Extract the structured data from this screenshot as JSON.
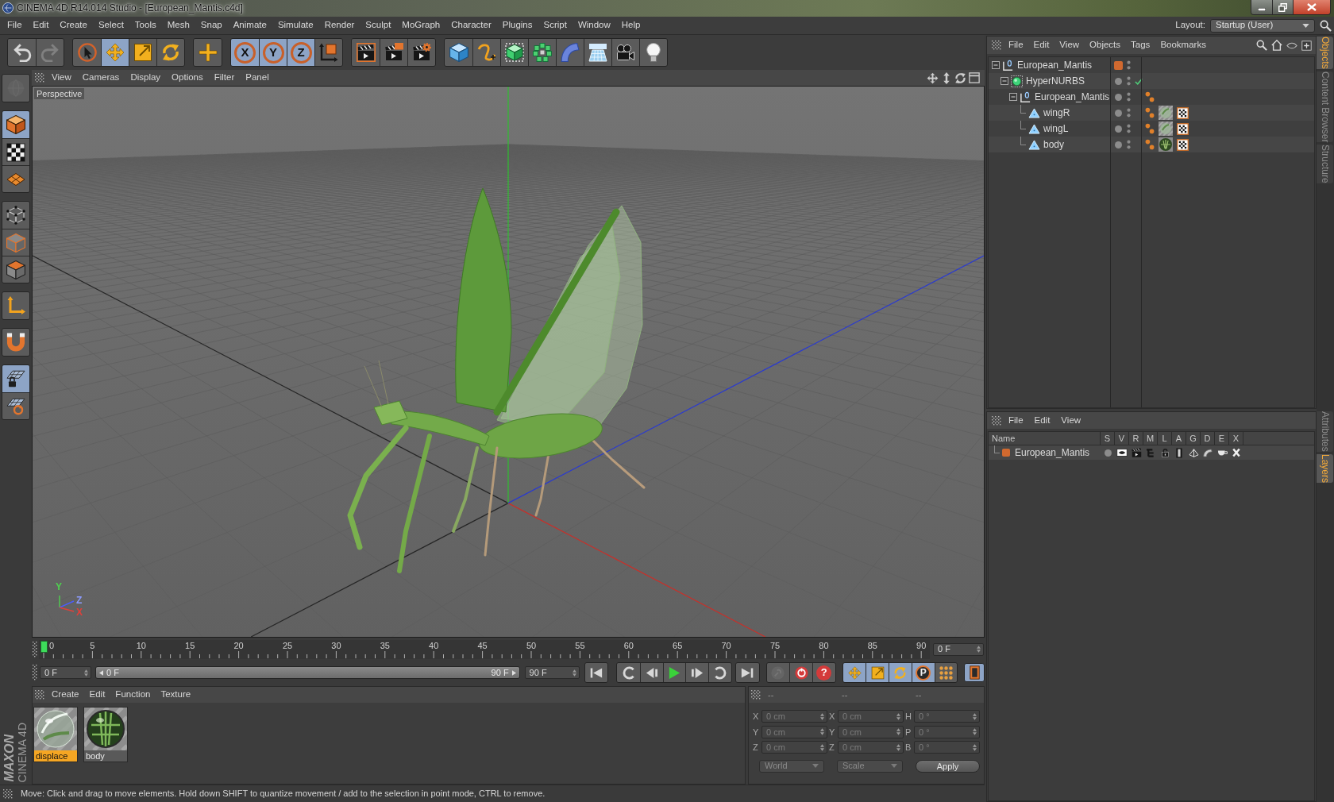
{
  "window": {
    "title": "CINEMA 4D R14.014 Studio - [European_Mantis.c4d]"
  },
  "menu_bar": {
    "items": [
      "File",
      "Edit",
      "Create",
      "Select",
      "Tools",
      "Mesh",
      "Snap",
      "Animate",
      "Simulate",
      "Render",
      "Sculpt",
      "MoGraph",
      "Character",
      "Plugins",
      "Script",
      "Window",
      "Help"
    ],
    "layout_label": "Layout:",
    "layout_value": "Startup (User)"
  },
  "toolbar": {
    "groups": [
      {
        "buttons": [
          {
            "kind": "undo",
            "disabled": false
          },
          {
            "kind": "redo",
            "disabled": true
          }
        ]
      },
      {
        "buttons": [
          {
            "kind": "live_selection",
            "selected": false
          },
          {
            "kind": "move",
            "selected": true
          },
          {
            "kind": "scale",
            "selected": false
          },
          {
            "kind": "rotate",
            "selected": false
          }
        ]
      },
      {
        "buttons": [
          {
            "kind": "add",
            "selected": false
          }
        ]
      },
      {
        "buttons": [
          {
            "kind": "axis",
            "label": "X",
            "selected": true
          },
          {
            "kind": "axis",
            "label": "Y",
            "selected": true
          },
          {
            "kind": "axis",
            "label": "Z",
            "selected": true
          },
          {
            "kind": "coordinates",
            "selected": false
          }
        ]
      },
      {
        "buttons": [
          {
            "kind": "render_view"
          },
          {
            "kind": "render_picture_viewer"
          },
          {
            "kind": "render_settings"
          }
        ]
      },
      {
        "buttons": [
          {
            "kind": "cube"
          },
          {
            "kind": "spline"
          },
          {
            "kind": "nurbs"
          },
          {
            "kind": "cloner"
          },
          {
            "kind": "deformer"
          },
          {
            "kind": "floor"
          },
          {
            "kind": "camera"
          },
          {
            "kind": "light"
          }
        ]
      }
    ]
  },
  "left_toolbar": {
    "groups": [
      {
        "buttons": [
          {
            "kind": "sphere",
            "disabled": true
          }
        ]
      },
      {
        "buttons": [
          {
            "kind": "model",
            "selected": true
          },
          {
            "kind": "texture",
            "selected": false
          },
          {
            "kind": "workplane",
            "selected": false
          }
        ]
      },
      {
        "buttons": [
          {
            "kind": "points",
            "selected": false
          },
          {
            "kind": "edges",
            "selected": false
          },
          {
            "kind": "polygons",
            "selected": false
          }
        ]
      },
      {
        "buttons": [
          {
            "kind": "axis_mode",
            "selected": false
          }
        ]
      },
      {
        "buttons": [
          {
            "kind": "magnet",
            "selected": false
          }
        ]
      },
      {
        "buttons": [
          {
            "kind": "snap",
            "selected": true
          },
          {
            "kind": "grid_snap",
            "selected": false
          }
        ]
      }
    ]
  },
  "logo": {
    "brand": "MAXON",
    "product": "CINEMA 4D"
  },
  "viewport": {
    "menu": [
      "View",
      "Cameras",
      "Display",
      "Options",
      "Filter",
      "Panel"
    ],
    "camera_label": "Perspective",
    "gizmo": [
      {
        "label": "Y",
        "color": "#4fd04f"
      },
      {
        "label": "Z",
        "color": "#8c9bff"
      },
      {
        "label": "X",
        "color": "#e0403a"
      }
    ]
  },
  "timeline": {
    "ticks": [
      "0",
      "5",
      "10",
      "15",
      "20",
      "25",
      "30",
      "35",
      "40",
      "45",
      "50",
      "55",
      "60",
      "65",
      "70",
      "75",
      "80",
      "85",
      "90"
    ],
    "playhead": {
      "level": 0
    },
    "current_frame": "0 F"
  },
  "playback": {
    "start_frame": "0 F",
    "range": {
      "start": "0 F",
      "end": "90 F",
      "level": 1
    },
    "end_frame": "90 F",
    "transport": [
      {
        "buttons": [
          {
            "kind": "first"
          }
        ]
      },
      {
        "buttons": [
          {
            "kind": "prev_key"
          },
          {
            "kind": "prev_frame"
          },
          {
            "kind": "play"
          },
          {
            "kind": "next_frame"
          },
          {
            "kind": "next_key"
          }
        ]
      },
      {
        "buttons": [
          {
            "kind": "last"
          }
        ]
      }
    ],
    "record": [
      {
        "kind": "record_active",
        "disabled": true
      },
      {
        "kind": "autokey",
        "disabled": false
      },
      {
        "kind": "keyframe_selection",
        "label": "?",
        "disabled": false
      }
    ],
    "key_tracks": [
      {
        "kind": "position",
        "selected": true
      },
      {
        "kind": "scale",
        "selected": true
      },
      {
        "kind": "rotation",
        "selected": true
      },
      {
        "kind": "parameter",
        "label": "P",
        "selected": true
      },
      {
        "kind": "point_level",
        "selected": false
      }
    ],
    "timeline_button": {
      "selected": true
    }
  },
  "materials": {
    "menu": [
      "Create",
      "Edit",
      "Function",
      "Texture"
    ],
    "items": [
      {
        "name": "displace",
        "kind": "glass",
        "selected": true
      },
      {
        "name": "body",
        "kind": "skin",
        "selected": false
      }
    ]
  },
  "coordinates": {
    "headers": [
      "--",
      "--",
      "--"
    ],
    "rows": [
      {
        "position_axis": "X",
        "position": "0 cm",
        "size_axis": "X",
        "size": "0 cm",
        "rotation_axis": "H",
        "rotation": "0 °"
      },
      {
        "position_axis": "Y",
        "position": "0 cm",
        "size_axis": "Y",
        "size": "0 cm",
        "rotation_axis": "P",
        "rotation": "0 °"
      },
      {
        "position_axis": "Z",
        "position": "0 cm",
        "size_axis": "Z",
        "size": "0 cm",
        "rotation_axis": "B",
        "rotation": "0 °"
      }
    ],
    "space": "World",
    "size_mode": "Scale",
    "apply": "Apply"
  },
  "status_bar": {
    "text": "Move: Click and drag to move elements. Hold down SHIFT to quantize movement / add to the selection in point mode, CTRL to remove."
  },
  "object_manager": {
    "menu": [
      "File",
      "Edit",
      "View",
      "Objects",
      "Tags",
      "Bookmarks"
    ],
    "tree": [
      {
        "name": "European_Mantis",
        "kind": "null",
        "expanded": true,
        "color": "#d0692f",
        "enabled": false,
        "children": [
          {
            "name": "HyperNURBS",
            "kind": "nurbs",
            "expanded": true,
            "enabled": true,
            "children": [
              {
                "name": "European_Mantis",
                "kind": "null",
                "expanded": true,
                "enabled": false,
                "tags": [
                  {
                    "kind": "phong"
                  }
                ],
                "children": [
                  {
                    "name": "wingR",
                    "kind": "polygon",
                    "enabled": false,
                    "tags": [
                      {
                        "kind": "phong"
                      },
                      {
                        "kind": "glass"
                      },
                      {
                        "kind": "uvw"
                      }
                    ]
                  },
                  {
                    "name": "wingL",
                    "kind": "polygon",
                    "enabled": false,
                    "tags": [
                      {
                        "kind": "phong"
                      },
                      {
                        "kind": "glass"
                      },
                      {
                        "kind": "uvw"
                      }
                    ]
                  },
                  {
                    "name": "body",
                    "kind": "polygon",
                    "enabled": false,
                    "tags": [
                      {
                        "kind": "phong"
                      },
                      {
                        "kind": "skin"
                      },
                      {
                        "kind": "uvw"
                      }
                    ]
                  }
                ]
              }
            ]
          }
        ]
      }
    ]
  },
  "layers": {
    "menu": [
      "File",
      "Edit",
      "View"
    ],
    "columns": [
      "Name",
      "S",
      "V",
      "R",
      "M",
      "L",
      "A",
      "G",
      "D",
      "E",
      "X"
    ],
    "rows": [
      {
        "name": "European_Mantis",
        "color": "#d0692f"
      }
    ]
  },
  "side_tabs": {
    "top": [
      {
        "label": "Objects",
        "selected": true
      },
      {
        "label": "Content Browser",
        "selected": false
      },
      {
        "label": "Structure",
        "selected": false
      }
    ],
    "bottom": [
      {
        "label": "Attributes",
        "selected": false
      },
      {
        "label": "Layers",
        "selected": true
      }
    ]
  }
}
